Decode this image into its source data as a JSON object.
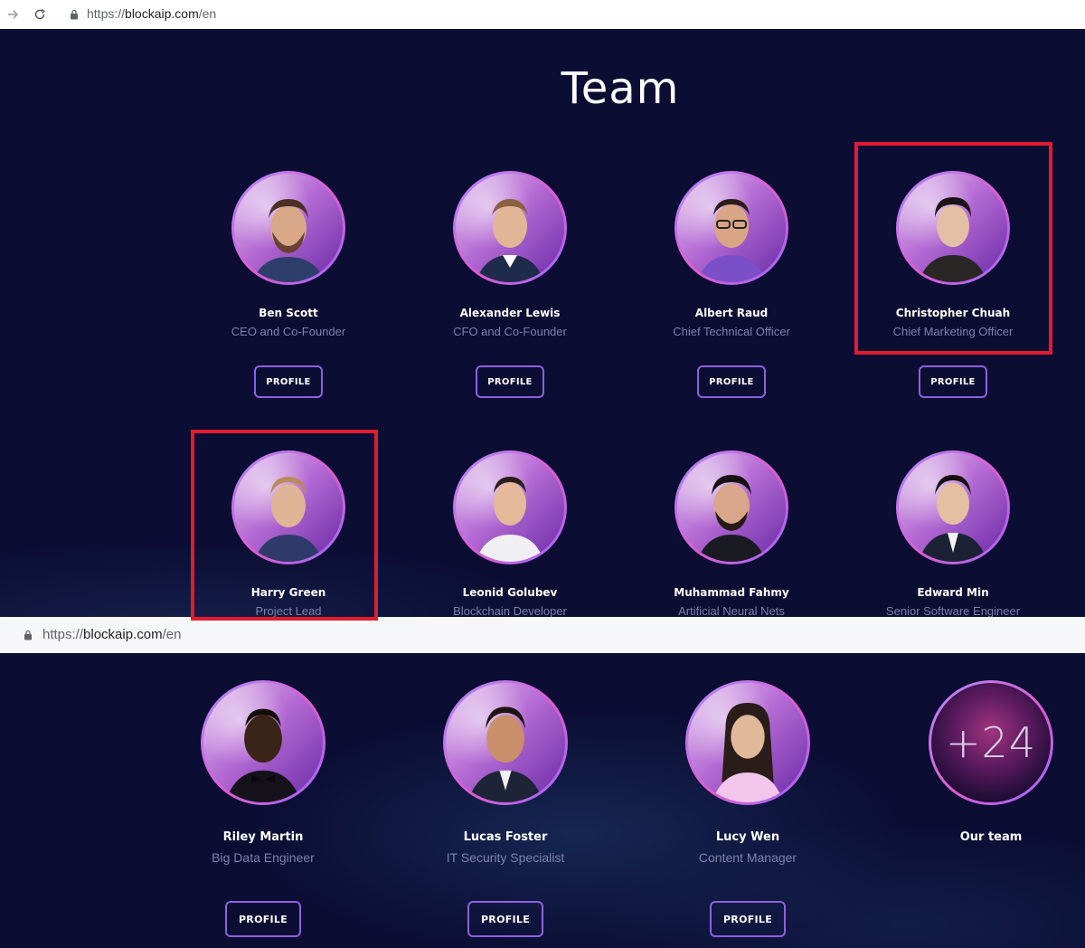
{
  "browser": {
    "bar1": {
      "url_scheme": "https://",
      "url_host": "blockaip.com",
      "url_path": "/en"
    },
    "bar2": {
      "url_scheme": "https://",
      "url_host": "blockaip.com",
      "url_path": "/en"
    }
  },
  "section": {
    "title": "Team"
  },
  "members_row1": [
    {
      "name": "Ben Scott",
      "role": "CEO and Co-Founder",
      "button": "PROFILE"
    },
    {
      "name": "Alexander Lewis",
      "role": "CFO and Co-Founder",
      "button": "PROFILE"
    },
    {
      "name": "Albert Raud",
      "role": "Chief Technical Officer",
      "button": "PROFILE"
    },
    {
      "name": "Christopher Chuah",
      "role": "Chief Marketing Officer",
      "button": "PROFILE"
    }
  ],
  "members_row2": [
    {
      "name": "Harry Green",
      "role": "Project Lead"
    },
    {
      "name": "Leonid Golubev",
      "role": "Blockchain Developer"
    },
    {
      "name": "Muhammad Fahmy",
      "role": "Artificial Neural Nets"
    },
    {
      "name": "Edward Min",
      "role": "Senior Software Engineer"
    }
  ],
  "members_row3": [
    {
      "name": "Riley Martin",
      "role": "Big Data Engineer",
      "button": "PROFILE"
    },
    {
      "name": "Lucas Foster",
      "role": "IT Security Specialist",
      "button": "PROFILE"
    },
    {
      "name": "Lucy Wen",
      "role": "Content Manager",
      "button": "PROFILE"
    }
  ],
  "more_team": {
    "count_label": "+24",
    "label": "Our team"
  },
  "colors": {
    "background": "#0b0d33",
    "accent_border": "#8f5fe0",
    "highlight": "#e01c2e",
    "role_text": "#7d82a8"
  }
}
